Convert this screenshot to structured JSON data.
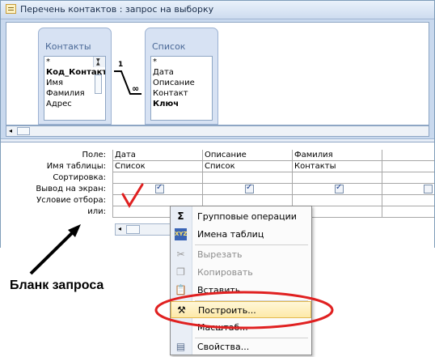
{
  "window": {
    "title": "Перечень контактов : запрос на выборку"
  },
  "tables": [
    {
      "name": "Контакты",
      "fields": [
        "*",
        "Код_Контакта",
        "Имя",
        "Фамилия",
        "Адрес"
      ],
      "bold_field": "Код_Контакта"
    },
    {
      "name": "Список",
      "fields": [
        "*",
        "Дата",
        "Описание",
        "Контакт",
        "Ключ"
      ],
      "bold_field": "Ключ"
    }
  ],
  "relationship": {
    "left_label": "1",
    "right_label": "∞"
  },
  "grid": {
    "row_labels": [
      "Поле:",
      "Имя таблицы:",
      "Сортировка:",
      "Вывод на экран:",
      "Условие отбора:",
      "или:"
    ],
    "columns": [
      {
        "field": "Дата",
        "table": "Список",
        "show": true
      },
      {
        "field": "Описание",
        "table": "Список",
        "show": true
      },
      {
        "field": "Фамилия",
        "table": "Контакты",
        "show": true
      },
      {
        "field": "",
        "table": "",
        "show": false
      }
    ]
  },
  "annotation": {
    "label": "Бланк запроса",
    "checkmark_color": "#e02020",
    "ellipse_color": "#e02020"
  },
  "context_menu": {
    "items": [
      {
        "label": "Групповые операции",
        "icon": "sigma-icon",
        "enabled": true
      },
      {
        "label": "Имена таблиц",
        "icon": "table-names-icon",
        "enabled": true
      },
      {
        "label": "Вырезать",
        "icon": "scissors-icon",
        "enabled": false
      },
      {
        "label": "Копировать",
        "icon": "copy-icon",
        "enabled": false
      },
      {
        "label": "Вставить",
        "icon": "paste-icon",
        "enabled": true
      },
      {
        "label": "Построить...",
        "icon": "build-wand-icon",
        "enabled": true,
        "highlighted": true
      },
      {
        "label": "Масштаб...",
        "icon": "zoom-icon",
        "enabled": true
      },
      {
        "label": "Свойства...",
        "icon": "properties-icon",
        "enabled": true
      }
    ]
  }
}
